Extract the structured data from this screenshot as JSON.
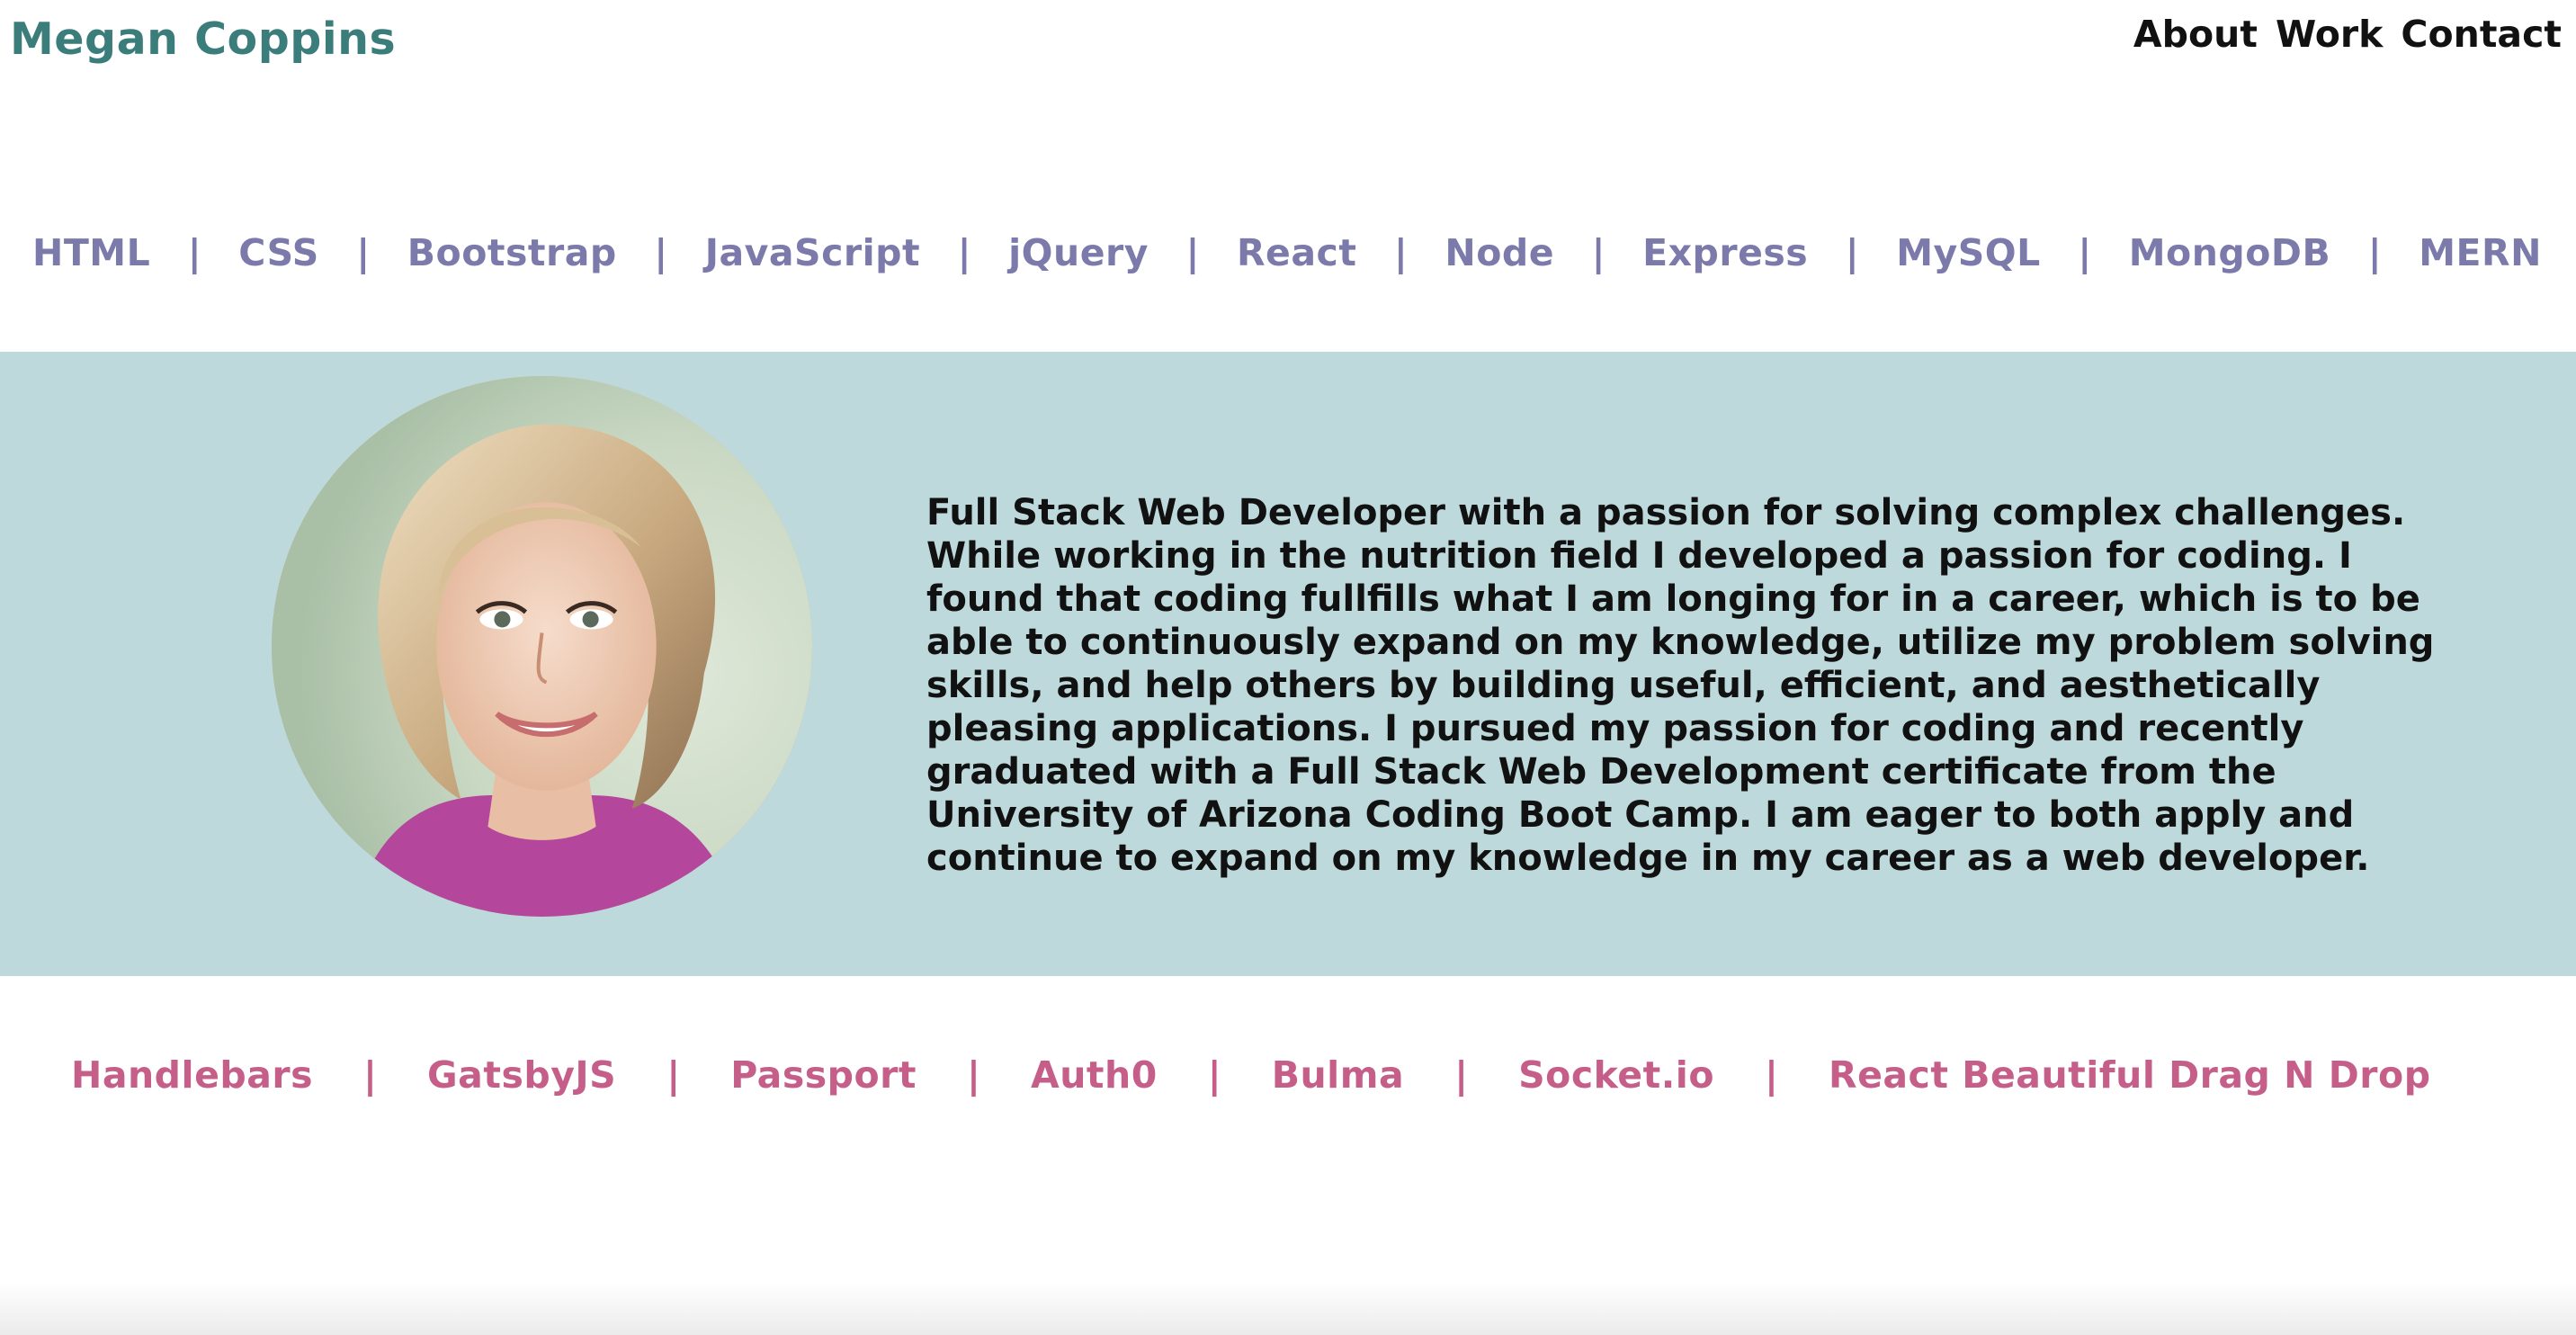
{
  "header": {
    "brand": "Megan Coppins",
    "nav": [
      "About",
      "Work",
      "Contact"
    ]
  },
  "skills_primary": [
    "HTML",
    "CSS",
    "Bootstrap",
    "JavaScript",
    "jQuery",
    "React",
    "Node",
    "Express",
    "MySQL",
    "MongoDB",
    "MERN"
  ],
  "skills_secondary": [
    "Handlebars",
    "GatsbyJS",
    "Passport",
    "Auth0",
    "Bulma",
    "Socket.io",
    "React Beautiful Drag N Drop"
  ],
  "separator": "|",
  "about": {
    "bio": "Full Stack Web Developer with a passion for solving complex challenges. While working in the nutrition field I developed a passion for coding. I found that coding fullfills what I am longing for in a career, which is to be able to continuously expand on my knowledge, utilize my problem solving skills, and help others by building useful, efficient, and aesthetically pleasing applications. I pursued my passion for coding and recently graduated with a Full Stack Web Development certificate from the University of Arizona Coding Boot Camp. I am eager to both apply and continue to expand on my knowledge in my career as a web developer."
  },
  "colors": {
    "brand": "#3b7d7b",
    "skills_primary": "#7b7aab",
    "skills_secondary": "#c55f89",
    "band": "#bdd9db"
  }
}
